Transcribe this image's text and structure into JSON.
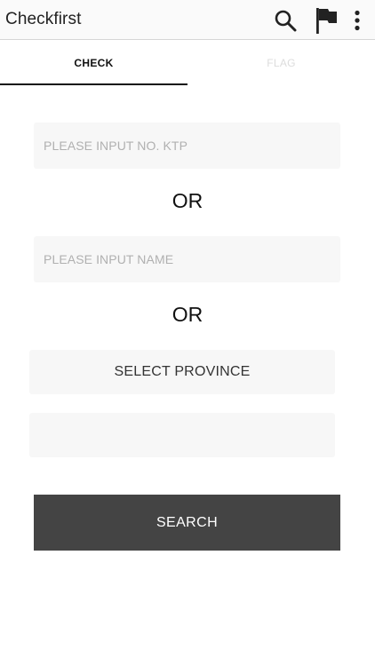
{
  "app": {
    "title": "Checkfirst"
  },
  "toolbar": {
    "icons": [
      "search-icon",
      "flag-icon",
      "more-vert-icon"
    ]
  },
  "tabs": [
    {
      "label": "CHECK",
      "active": true
    },
    {
      "label": "FLAG",
      "active": false
    }
  ],
  "form": {
    "ktp_placeholder": "PLEASE INPUT NO. KTP",
    "or_label": "OR",
    "name_placeholder": "PLEASE INPUT NAME",
    "or_label_2": "OR",
    "province_label": "SELECT PROVINCE",
    "city_label": "",
    "search_label": "SEARCH"
  },
  "colors": {
    "appbar_bg": "#fafafa",
    "field_bg": "#f7f7f7",
    "button_bg": "#444444",
    "tab_active": "#111111",
    "tab_inactive": "#dcdcdc"
  }
}
